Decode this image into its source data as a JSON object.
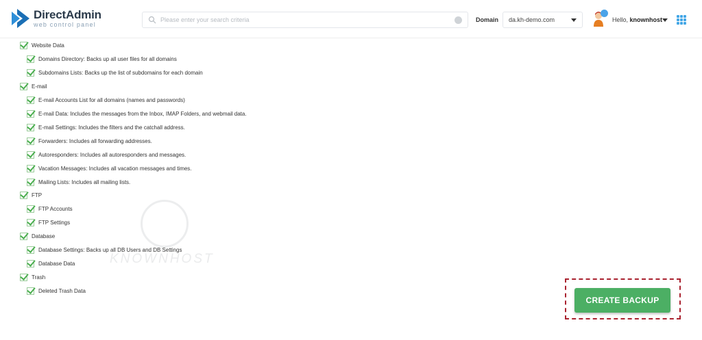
{
  "header": {
    "logo_title": "DirectAdmin",
    "logo_subtitle": "web control panel",
    "search_placeholder": "Please enter your search criteria",
    "domain_label": "Domain",
    "domain_value": "da.kh-demo.com",
    "greeting": "Hello,",
    "username": "knownhost"
  },
  "sections": [
    {
      "label": "Website Data",
      "checked": true,
      "items": [
        {
          "label": "Domains Directory: Backs up all user files for all domains",
          "checked": true
        },
        {
          "label": "Subdomains Lists: Backs up the list of subdomains for each domain",
          "checked": true
        }
      ]
    },
    {
      "label": "E-mail",
      "checked": true,
      "items": [
        {
          "label": "E-mail Accounts List for all domains (names and passwords)",
          "checked": true
        },
        {
          "label": "E-mail Data: Includes the messages from the Inbox, IMAP Folders, and webmail data.",
          "checked": true
        },
        {
          "label": "E-mail Settings: Includes the filters and the catchall address.",
          "checked": true
        },
        {
          "label": "Forwarders: Includes all forwarding addresses.",
          "checked": true
        },
        {
          "label": "Autoresponders: Includes all autoresponders and messages.",
          "checked": true
        },
        {
          "label": "Vacation Messages: Includes all vacation messages and times.",
          "checked": true
        },
        {
          "label": "Mailing Lists: Includes all mailing lists.",
          "checked": true
        }
      ]
    },
    {
      "label": "FTP",
      "checked": true,
      "items": [
        {
          "label": "FTP Accounts",
          "checked": true
        },
        {
          "label": "FTP Settings",
          "checked": true
        }
      ]
    },
    {
      "label": "Database",
      "checked": true,
      "items": [
        {
          "label": "Database Settings: Backs up all DB Users and DB Settings",
          "checked": true
        },
        {
          "label": "Database Data",
          "checked": true
        }
      ]
    },
    {
      "label": "Trash",
      "checked": true,
      "items": [
        {
          "label": "Deleted Trash Data",
          "checked": true
        }
      ]
    }
  ],
  "watermark": "KNOWNHOST",
  "actions": {
    "create_backup_label": "CREATE BACKUP"
  },
  "colors": {
    "accent_green": "#4caf64",
    "highlight_border": "#a9212e",
    "brand_blue": "#2f8fd8"
  }
}
